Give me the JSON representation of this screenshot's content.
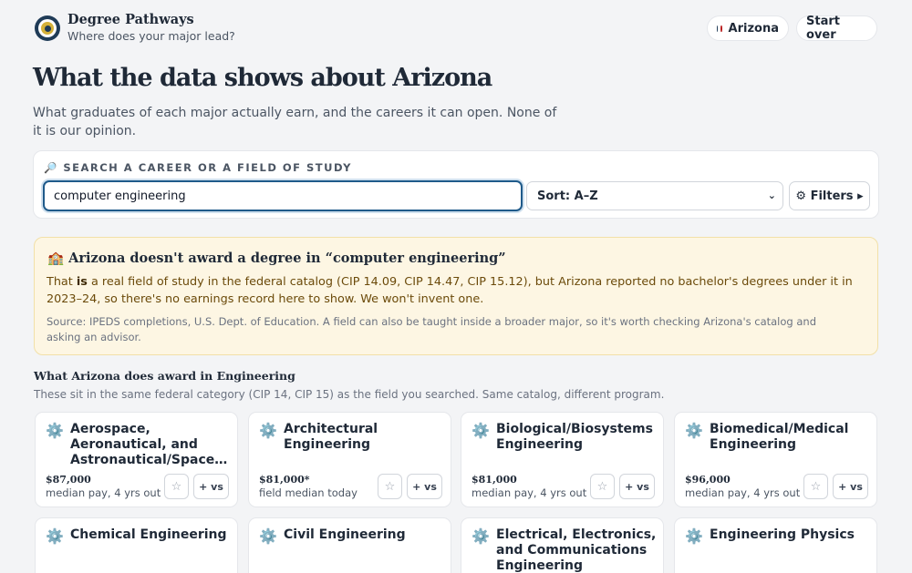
{
  "brand": {
    "title": "Degree Pathways",
    "subtitle": "Where does your major lead?"
  },
  "header": {
    "state_label": "Arizona",
    "state_colors": [
      "#1f3b57",
      "#b91c1c"
    ],
    "start_over_label": "Start over"
  },
  "page": {
    "title": "What the data shows about Arizona",
    "intro": "What graduates of each major actually earn, and the careers it can open. None of it is our opinion."
  },
  "search": {
    "label": "SEARCH A CAREER OR A FIELD OF STUDY",
    "icon": "magnifier-icon",
    "value": "computer engineering",
    "sort_value": "Sort: A–Z",
    "filters_label": "⚙ Filters ▸"
  },
  "notice": {
    "title": "🏫 Arizona doesn't award a degree in “computer engineering”",
    "body_before": "That ",
    "body_bold": "is",
    "body_after": " a real field of study in the federal catalog (CIP 14.09, CIP 14.47, CIP 15.12), but Arizona reported no bachelor's degrees under it in 2023–24, so there's no earnings record here to show. We won't invent one.",
    "source": "Source: IPEDS completions, U.S. Dept. of Education. A field can also be taught inside a broader major, so it's worth checking Arizona's catalog and asking an advisor."
  },
  "section": {
    "title": "What Arizona does award in Engineering",
    "subtitle": "These sit in the same federal category (CIP 14, CIP 15) as the field you searched. Same catalog, different program."
  },
  "cards": [
    {
      "name": "Aerospace, Aeronautical, and Astronautical/Space…",
      "pay": "$87,000",
      "pay_note": "median pay, 4 yrs out",
      "icon": "gear-icon"
    },
    {
      "name": "Architectural Engineering",
      "pay": "$81,000*",
      "pay_note": "field median today",
      "icon": "gear-icon"
    },
    {
      "name": "Biological/Biosystems Engineering",
      "pay": "$81,000",
      "pay_note": "median pay, 4 yrs out",
      "icon": "gear-icon"
    },
    {
      "name": "Biomedical/Medical Engineering",
      "pay": "$96,000",
      "pay_note": "median pay, 4 yrs out",
      "icon": "gear-icon"
    },
    {
      "name": "Chemical Engineering",
      "icon": "gear-icon"
    },
    {
      "name": "Civil Engineering",
      "icon": "gear-icon"
    },
    {
      "name": "Electrical, Electronics, and Communications Engineering",
      "icon": "gear-icon"
    },
    {
      "name": "Engineering Physics",
      "icon": "gear-icon"
    }
  ],
  "card_actions": {
    "star_label": "☆",
    "vs_label": "+ vs"
  }
}
